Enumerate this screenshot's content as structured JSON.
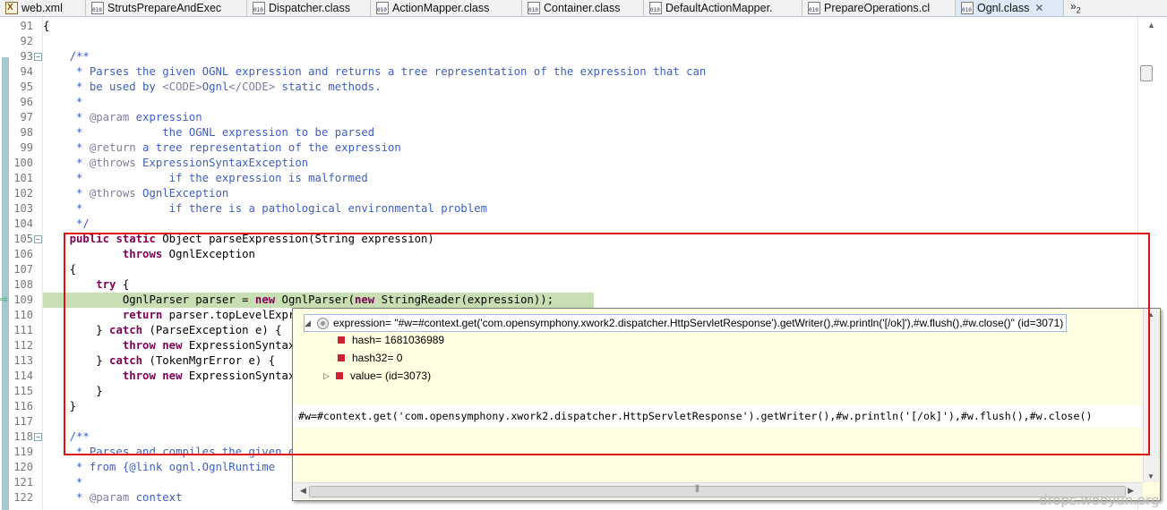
{
  "tabs": [
    {
      "label": "web.xml",
      "icon": "xml-file-icon"
    },
    {
      "label": "StrutsPrepareAndExec",
      "icon": "class-file-icon"
    },
    {
      "label": "Dispatcher.class",
      "icon": "class-file-icon"
    },
    {
      "label": "ActionMapper.class",
      "icon": "class-file-icon"
    },
    {
      "label": "Container.class",
      "icon": "class-file-icon"
    },
    {
      "label": "DefaultActionMapper.",
      "icon": "class-file-icon"
    },
    {
      "label": "PrepareOperations.cl",
      "icon": "class-file-icon"
    },
    {
      "label": "Ognl.class",
      "icon": "class-file-icon",
      "active": true,
      "close": "✕"
    }
  ],
  "tab_overflow": {
    "symbol": "»",
    "count": "2"
  },
  "code": {
    "lines": [
      {
        "n": "91",
        "t": "{"
      },
      {
        "n": "92",
        "t": ""
      },
      {
        "n": "93",
        "t": "    /**",
        "fold": true
      },
      {
        "n": "94",
        "t": "     * Parses the given OGNL expression and returns a tree representation of the expression that can"
      },
      {
        "n": "95",
        "t": "     * be used by <CODE>Ognl</CODE> static methods."
      },
      {
        "n": "96",
        "t": "     *"
      },
      {
        "n": "97",
        "t": "     * @param expression"
      },
      {
        "n": "98",
        "t": "     *            the OGNL expression to be parsed"
      },
      {
        "n": "99",
        "t": "     * @return a tree representation of the expression"
      },
      {
        "n": "100",
        "t": "     * @throws ExpressionSyntaxException"
      },
      {
        "n": "101",
        "t": "     *             if the expression is malformed"
      },
      {
        "n": "102",
        "t": "     * @throws OgnlException"
      },
      {
        "n": "103",
        "t": "     *             if there is a pathological environmental problem"
      },
      {
        "n": "104",
        "t": "     */"
      },
      {
        "n": "105",
        "t": "    public static Object parseExpression(String expression)",
        "fold": true
      },
      {
        "n": "106",
        "t": "            throws OgnlException"
      },
      {
        "n": "107",
        "t": "    {"
      },
      {
        "n": "108",
        "t": "        try {"
      },
      {
        "n": "109",
        "t": "            OgnlParser parser = new OgnlParser(new StringReader(expression));",
        "current": true
      },
      {
        "n": "110",
        "t": "            return parser.topLevelExpression();"
      },
      {
        "n": "111",
        "t": "        } catch (ParseException e) {"
      },
      {
        "n": "112",
        "t": "            throw new ExpressionSyntaxException(expression, e);"
      },
      {
        "n": "113",
        "t": "        } catch (TokenMgrError e) {"
      },
      {
        "n": "114",
        "t": "            throw new ExpressionSyntaxException(expression, e);"
      },
      {
        "n": "115",
        "t": "        }"
      },
      {
        "n": "116",
        "t": "    }"
      },
      {
        "n": "117",
        "t": ""
      },
      {
        "n": "118",
        "t": "    /**",
        "fold": true
      },
      {
        "n": "119",
        "t": "     * Parses and compiles the given expression"
      },
      {
        "n": "120",
        "t": "     * from {@link ognl.OgnlRuntime"
      },
      {
        "n": "121",
        "t": "     *"
      },
      {
        "n": "122",
        "t": "     * @param context"
      }
    ]
  },
  "popup": {
    "root": "expression= \"#w=#context.get('com.opensymphony.xwork2.dispatcher.HttpServletResponse').getWriter(),#w.println('[/ok]'),#w.flush(),#w.close()\" (id=3071)",
    "fields": [
      {
        "label": "hash= 1681036989"
      },
      {
        "label": "hash32= 0"
      },
      {
        "label": "value=  (id=3073)",
        "expandable": true
      }
    ],
    "detail": "#w=#context.get('com.opensymphony.xwork2.dispatcher.HttpServletResponse').getWriter(),#w.println('[/ok]'),#w.flush(),#w.close()"
  },
  "watermark": "drops.wooyun.org",
  "colors": {
    "annotation": "#e01010",
    "current_line": "#c8dfb3",
    "popup_bg": "#ffffe1"
  }
}
